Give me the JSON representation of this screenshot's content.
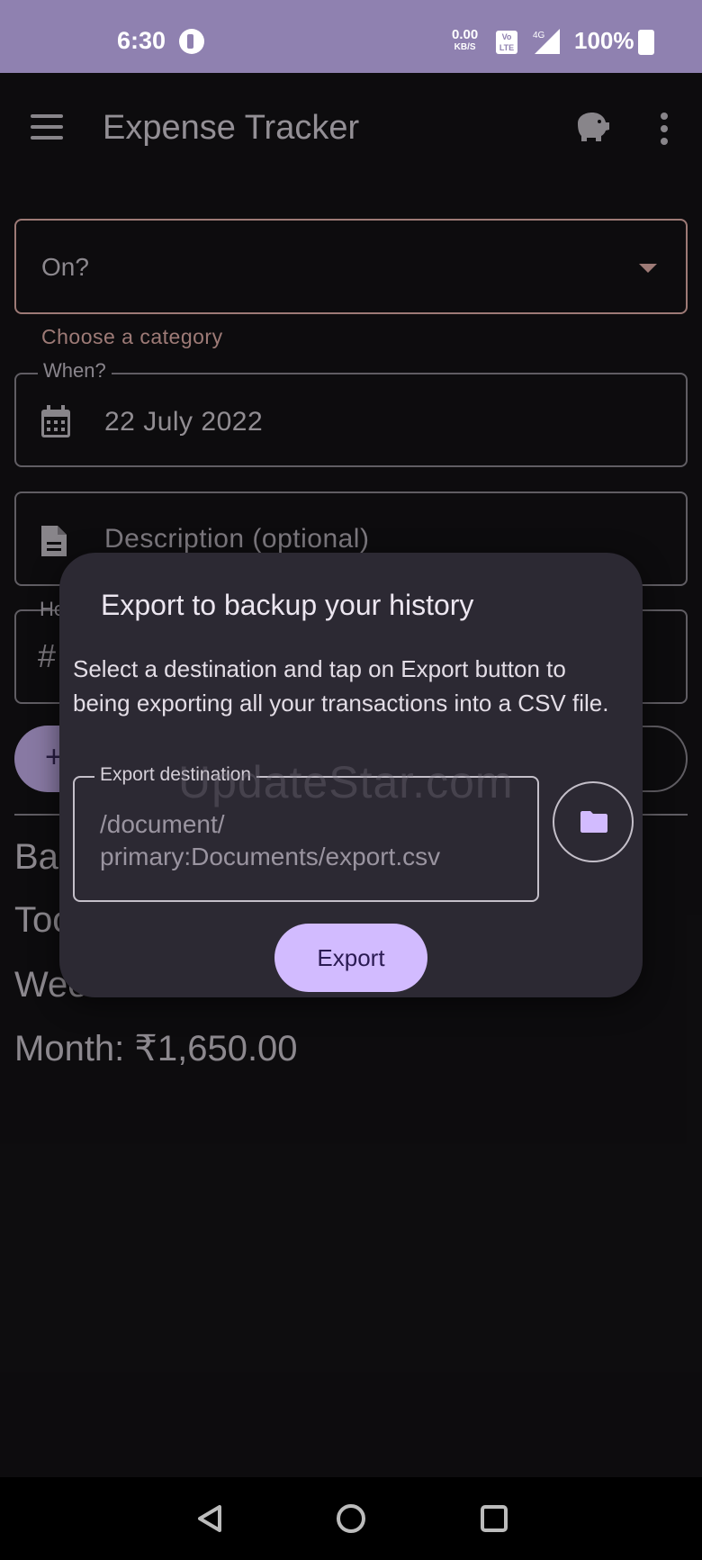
{
  "status_bar": {
    "time": "6:30",
    "speed_value": "0.00",
    "speed_unit": "KB/S",
    "network": "4G",
    "lte_label": "Vo LTE",
    "battery": "100%"
  },
  "app_bar": {
    "title": "Expense Tracker",
    "icons": [
      "menu-icon",
      "piggy-bank-icon",
      "more-vert-icon"
    ]
  },
  "form": {
    "category_value": "On?",
    "category_error": "Choose a category",
    "date_label": "When?",
    "date_value": "22 July 2022",
    "description_placeholder": "Description (optional)",
    "amount_label_partial": "Ho",
    "amount_prefix_partial": "#",
    "add_button_partial": "+"
  },
  "summary": {
    "balance_partial": "Ba",
    "today_partial": "Too",
    "week_partial": "Wee",
    "month": "Month: ₹1,650.00"
  },
  "dialog": {
    "title": "Export to backup your history",
    "body": "Select a destination and tap on Export button to being exporting all your transactions into a CSV file.",
    "destination_label": "Export destination",
    "destination_value": "/document/\nprimary:Documents/export.csv",
    "export_button": "Export"
  },
  "watermark": "UpdateStar.com",
  "colors": {
    "status_bar": "#8f81b0",
    "background": "#141316",
    "dialog": "#2c2933",
    "primary_button": "#d2bbff",
    "error": "#e8b4ae"
  }
}
